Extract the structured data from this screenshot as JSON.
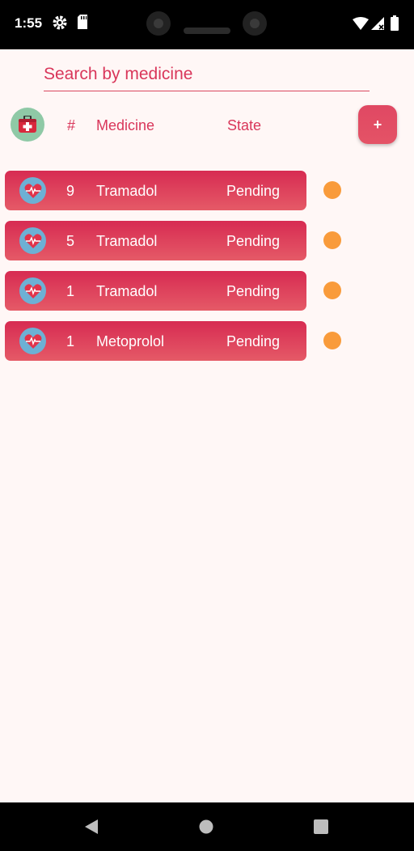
{
  "status_bar": {
    "time": "1:55",
    "icons": [
      "gear-icon",
      "sd-card-icon",
      "wifi-icon",
      "signal-icon",
      "battery-icon"
    ]
  },
  "search": {
    "placeholder": "Search by medicine",
    "value": ""
  },
  "header": {
    "number_label": "#",
    "medicine_label": "Medicine",
    "state_label": "State",
    "add_label": "+"
  },
  "rows": [
    {
      "count": "9",
      "medicine": "Tramadol",
      "state": "Pending"
    },
    {
      "count": "5",
      "medicine": "Tramadol",
      "state": "Pending"
    },
    {
      "count": "1",
      "medicine": "Tramadol",
      "state": "Pending"
    },
    {
      "count": "1",
      "medicine": "Metoprolol",
      "state": "Pending"
    }
  ],
  "colors": {
    "accent": "#d9365a",
    "row_gradient_top": "#d72b52",
    "row_gradient_bottom": "#e55a67",
    "pending_status": "#f99b3b",
    "background": "#fff7f6"
  },
  "nav_bar": {
    "icons": [
      "back-icon",
      "home-icon",
      "recents-icon"
    ]
  }
}
